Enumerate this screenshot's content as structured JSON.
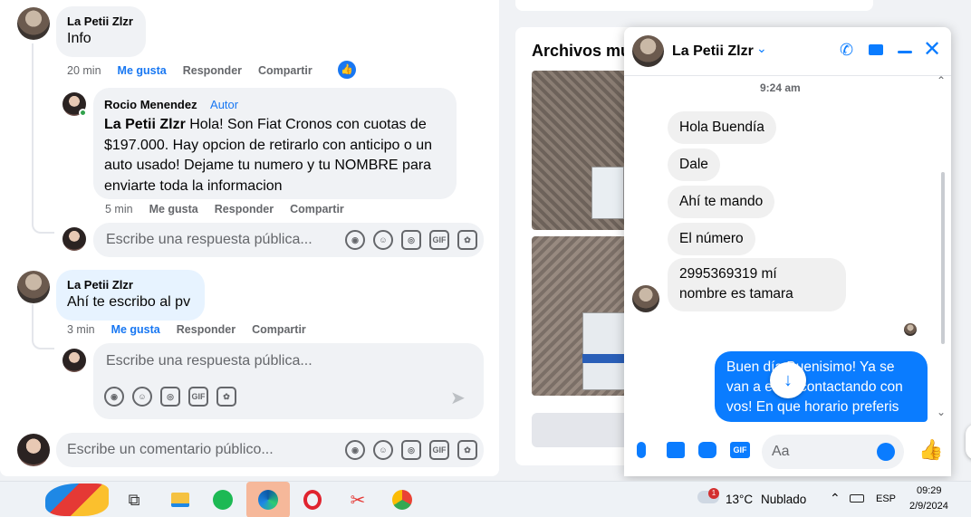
{
  "comments": {
    "c1": {
      "author": "La Petii Zlzr",
      "text": "Info",
      "time": "20 min",
      "like": "Me gusta",
      "reply": "Responder",
      "share": "Compartir"
    },
    "c2": {
      "author": "Rocio Menendez",
      "badge": "Autor",
      "mention": "La Petii Zlzr",
      "text": " Hola! Son Fiat Cronos con cuotas de $197.000. Hay opcion de retirarlo con anticipo o un auto usado! Dejame tu numero y tu NOMBRE para enviarte toda la informacion",
      "time": "5 min",
      "like": "Me gusta",
      "reply": "Responder",
      "share": "Compartir"
    },
    "reply1_placeholder": "Escribe una respuesta pública...",
    "c3": {
      "author": "La Petii Zlzr",
      "text": "Ahí te escribo al pv",
      "time": "3 min",
      "like": "Me gusta",
      "reply": "Responder",
      "share": "Compartir"
    },
    "reply2_placeholder": "Escribe una respuesta pública...",
    "comment_placeholder": "Escribe un comentario público...",
    "icon_labels": {
      "gif": "GIF"
    }
  },
  "media": {
    "title": "Archivos mu"
  },
  "chat": {
    "name": "La Petii Zlzr",
    "timestamp": "9:24 am",
    "messages": [
      {
        "text": "Hola Buendía"
      },
      {
        "text": "Dale"
      },
      {
        "text": "Ahí te mando"
      },
      {
        "text": "El número"
      },
      {
        "line1": "2995369319 mí",
        "line2": "nombre es tamara"
      }
    ],
    "my_message": "Buen día Buenisimo! Ya se van a estar contactando con vos! En que horario preferis",
    "input_placeholder": "Aa",
    "accent": "#0a7cff"
  },
  "taskbar": {
    "weather_badge": "1",
    "temp": "13°C",
    "condition": "Nublado",
    "lang": "ESP",
    "time": "09:29",
    "date": "2/9/2024"
  }
}
